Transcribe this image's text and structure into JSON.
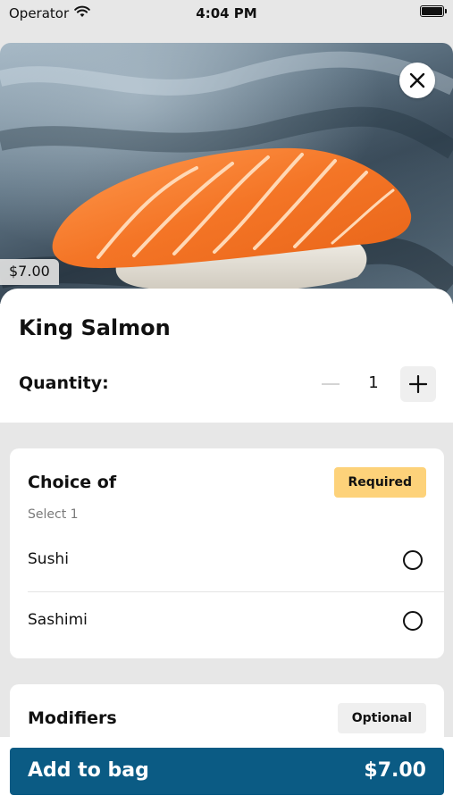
{
  "status_bar": {
    "carrier": "Operator",
    "time": "4:04 PM",
    "wifi_icon": "wifi-icon",
    "battery_icon": "battery-icon"
  },
  "hero": {
    "image": "salmon-nigiri-photo",
    "price": "$7.00",
    "close_icon": "close-icon"
  },
  "item": {
    "title": "King Salmon",
    "quantity_label": "Quantity:",
    "quantity_value": "1",
    "minus_icon": "minus-icon",
    "plus_icon": "plus-icon"
  },
  "choice_group": {
    "title": "Choice of",
    "badge": "Required",
    "subtitle": "Select 1",
    "options": [
      {
        "label": "Sushi",
        "selected": false
      },
      {
        "label": "Sashimi",
        "selected": false
      }
    ]
  },
  "modifiers_group": {
    "title": "Modifiers",
    "badge": "Optional"
  },
  "footer": {
    "button_label": "Add to bag",
    "button_price": "$7.00"
  },
  "colors": {
    "primary": "#0b5b84",
    "required_badge": "#fdd27a",
    "optional_badge": "#efefef",
    "background": "#e7e7e7"
  }
}
